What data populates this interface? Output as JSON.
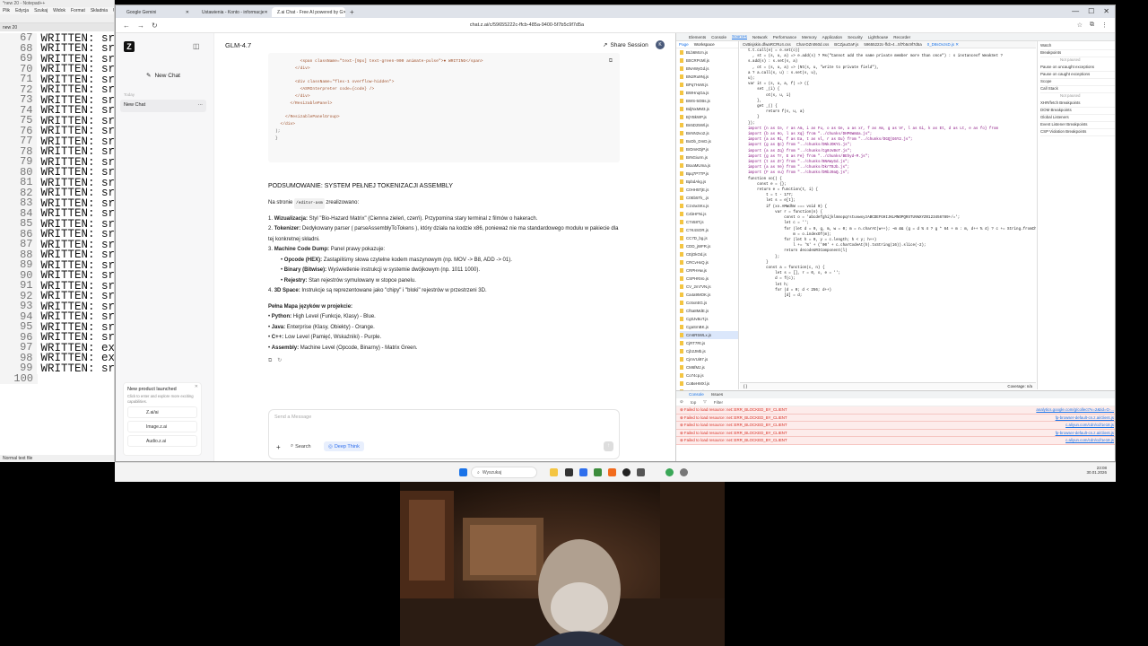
{
  "notepad": {
    "title": "*new 20 - Notepad++",
    "menu": [
      "Plik",
      "Edycja",
      "Szukaj",
      "Widok",
      "Format",
      "Składnia",
      "Ustawienia"
    ],
    "lines": [
      {
        "n": "67",
        "t": "WRITTEN: sr"
      },
      {
        "n": "68",
        "t": "WRITTEN: sr"
      },
      {
        "n": "69",
        "t": "WRITTEN: sr"
      },
      {
        "n": "70",
        "t": "WRITTEN: sr"
      },
      {
        "n": "71",
        "t": "WRITTEN: sr"
      },
      {
        "n": "72",
        "t": "WRITTEN: sr"
      },
      {
        "n": "73",
        "t": "WRITTEN: sr"
      },
      {
        "n": "74",
        "t": "WRITTEN: sr"
      },
      {
        "n": "75",
        "t": "WRITTEN: sr"
      },
      {
        "n": "76",
        "t": "WRITTEN: sr"
      },
      {
        "n": "77",
        "t": "WRITTEN: sr"
      },
      {
        "n": "78",
        "t": "WRITTEN: sr"
      },
      {
        "n": "79",
        "t": "WRITTEN: sr"
      },
      {
        "n": "80",
        "t": "WRITTEN: sr"
      },
      {
        "n": "81",
        "t": "WRITTEN: sr"
      },
      {
        "n": "82",
        "t": "WRITTEN: sr"
      },
      {
        "n": "83",
        "t": "WRITTEN: sr"
      },
      {
        "n": "84",
        "t": "WRITTEN: sr"
      },
      {
        "n": "85",
        "t": "WRITTEN: sr"
      },
      {
        "n": "86",
        "t": "WRITTEN: sr"
      },
      {
        "n": "87",
        "t": "WRITTEN: sr"
      },
      {
        "n": "88",
        "t": "WRITTEN: sr"
      },
      {
        "n": "89",
        "t": "WRITTEN: sr"
      },
      {
        "n": "90",
        "t": "WRITTEN: sr"
      },
      {
        "n": "91",
        "t": "WRITTEN: sr"
      },
      {
        "n": "92",
        "t": "WRITTEN: sr"
      },
      {
        "n": "93",
        "t": "WRITTEN: sr"
      },
      {
        "n": "94",
        "t": "WRITTEN: sr"
      },
      {
        "n": "95",
        "t": "WRITTEN: sr"
      },
      {
        "n": "96",
        "t": "WRITTEN: sr"
      },
      {
        "n": "97",
        "t": "WRITTEN: ex"
      },
      {
        "n": "98",
        "t": "WRITTEN: ex"
      },
      {
        "n": "99",
        "t": "WRITTEN: sr"
      },
      {
        "n": "100",
        "t": ""
      }
    ],
    "status": "Normal text file"
  },
  "browser": {
    "tabs": [
      {
        "label": "Google Gemini",
        "active": false
      },
      {
        "label": "Ustawienia - Konto - informacje",
        "active": false
      },
      {
        "label": "Z.ai Chat - Free AI powered by G",
        "active": true
      }
    ],
    "url": "chat.z.ai/c/59655222c-ffcb-485a-9400-5f7b5c9f7d5a"
  },
  "glm": {
    "new_chat": "New Chat",
    "today": "Today",
    "history_item": "New Chat",
    "promo_title": "New product launched",
    "promo_text": "Click to enter and explore more exciting capabilities.",
    "promo_links": [
      "Z.ai/ai",
      "Image.z.ai",
      "Audio.z.ai"
    ],
    "model": "GLM-4.7",
    "share": "Share Session",
    "code_lines": [
      "          <span className=\"text-[9px] text-green-900 animate-pulse\">● WRITING</span>",
      "        </div>",
      "",
      "        <div className=\"flex-1 overflow-hidden\">",
      "          <ASMInterpreter code={code} />",
      "        </div>",
      "      </ResizablePanel>",
      "",
      "    </ResizablePanelGroup>",
      "  </div>",
      ");",
      "}"
    ],
    "heading": "PODSUMOWANIE: SYSTEM PEŁNEJ TOKENIZACJI ASSEMBLY",
    "intro_pre": "Na stronie",
    "intro_code": "/editor-asm",
    "intro_post": "zrealizowano:",
    "items": [
      {
        "num": "1.",
        "bold": "Wizualizacja:",
        "text": " Styl \"Bio-Hazard Matrix\" (Ciemna zieleń, czerń). Przypomina stary terminal z filmów o hakerach."
      },
      {
        "num": "2.",
        "bold": "Tokenizer:",
        "text": " Dedykowany parser ( parseAssemblyToTokens ), który działa na kodzie x86, ponieważ nie ma standardowego modułu w pakiecie dla tej konkretnej składni."
      },
      {
        "num": "3.",
        "bold": "Machine Code Dump:",
        "text": " Panel prawy pokazuje:"
      }
    ],
    "subitems": [
      {
        "bold": "Opcode (HEX):",
        "text": " Zastąpiliśmy słowa czytelne kodem maszynowym (np. MOV -> B8, ADD -> 01)."
      },
      {
        "bold": "Binary (Bitwise):",
        "text": " Wyświetlenie instrukcji w systemie dwójkowym (np. 1011 1000)."
      },
      {
        "bold": "Rejestry:",
        "text": " Stan rejestrów symulowany w stopce panelu."
      }
    ],
    "item4": {
      "num": "4.",
      "bold": "3D Space:",
      "text": " Instrukcje są reprezentowane jako \"chipy\" i \"bloki\" rejestrów w przestrzeni 3D."
    },
    "map_title": "Pełna Mapa języków w projekcie:",
    "map": [
      {
        "bold": "Python:",
        "text": " High Level (Funkcje, Klasy) - Blue."
      },
      {
        "bold": "Java:",
        "text": " Enterprise (Klasy, Obiekty) - Orange."
      },
      {
        "bold": "C++:",
        "text": " Low Level (Pamięć, Wskaźniki) - Purple."
      },
      {
        "bold": "Assembly:",
        "text": " Machine Level (Opcode, Binarny) - Matrix Green."
      }
    ],
    "input_placeholder": "Send a Message",
    "search": "Search",
    "deep_think": "Deep Think"
  },
  "devtools": {
    "panels": [
      "Elements",
      "Console",
      "Sources",
      "Network",
      "Performance",
      "Memory",
      "Application",
      "Security",
      "Lighthouse",
      "Recorder"
    ],
    "active_panel": "Sources",
    "nav_tabs": [
      "Page",
      "Workspace"
    ],
    "files": [
      "BLb6Mcm.js",
      "B0CRPcMl.js",
      "BNAWyGd.js",
      "BN2Ru9Nj.js",
      "BPq7HxW.js",
      "BWHnqGa.js",
      "BWS-5OBs.js",
      "BdjNxMM3.js",
      "BjYBkWP.js",
      "Bn5D25Wl.js",
      "BnNN2vo2.js",
      "BoDb_DmD.js",
      "BrDmKDjP.js",
      "BrNGiurm.js",
      "BsxaMUma.js",
      "Bpq7P7TP.js",
      "BpbdAkg.js",
      "C0HH5TjE.js",
      "C0Eb5Tk_.js",
      "C1VaxSKx.js",
      "C4bHFNi.js",
      "C7n58T.js",
      "C7K4SOR.js",
      "CC7D_bg.js",
      "CDD_jWFR.js",
      "CEjDkOd.js",
      "CRCvHxQ.js",
      "CRPHHw.js",
      "CSPHNVo.js",
      "CV_2m7VN.js",
      "Ca4a9MOK.js",
      "Cc6xnEG.js",
      "Cf5a8MdE.js",
      "Cg0JvBoT.js",
      "CgaSmBK.js",
      "Cm6R5WLx.js",
      "CjRT7Rt.js",
      "Cjb2JMb.js",
      "CjmVUi97.js",
      "CM6fMJ.js",
      "Co74cp.js",
      "CoBeHMXl.js",
      "CqjVV_o.js",
      "D0QbUOM7.js",
      "DdwbCRM.js",
      "DTzG6ppk.js",
      "DTVCHvwK.js",
      "DBhQ9c.js"
    ],
    "code_lines": [
      "  t.t.call(e) = e.set(o))",
      "    , st = (s, u, a) => e.add(s) ? Ms(\"Cannot add the same private member more than once\") : s instanceof WeakSet ?",
      "  s.add(s) : s.set(s, a)",
      "    , ot = (s, u, a) => (Nt(s, u, \"write to private field\"),",
      "  a ? a.call(s, u) : s.set(s, u),",
      "  u);",
      "  var it = (s, u, a, f) => ({",
      "      set _(i) {",
      "          ot(s, u, i)",
      "      },",
      "      get _() {",
      "          return f(s, u, a)",
      "      }",
      "  });",
      "  import {n as Ce, r as Am, i as Fu, o as Ge, a as xr, f as Am, g as Vr, l as Gi, k as Et, d as Lt, e as fo} from",
      "  import {b as Ho, l as Xq} from \"../chunks/DHP6WmUa.js\";",
      "  import {a as Ri, f as Ea, t as vl, r as Eu} from \"../chunks/DGQjG6Y2.js\";",
      "  import {g as Qc} from \"../chunks/DNkJOKY1.js\";",
      "  import {a as Zq} from \"../chunks/Cg0JvBoT.js\";",
      "  import {g as Tr, E as Fe} from \"../chunks/BEhyd-M.js\";",
      "  import {t as Zr} from \"../chunks/BNAWyGd.js\";",
      "  import {a as Ve} from \"../chunks/DkrTBJb.js\";",
      "  import {F as su} from \"../chunks/DRbJ0aQ.js\";",
      "  function xo() {",
      "      const e = {};",
      "      return e = function(t, i) {",
      "          t = t - 177;",
      "          let s = e[t];",
      "          if (xo.AMWdhW === void 0) {",
      "              var r = function(n) {",
      "                  const o = 'abcdefghijklmnopqrstuvwxyzABCDEFGHIJKLMNOPQRSTUVWXYZ0123456789+/=';",
      "                  let c = '';",
      "                  for (let d = 0, g, m, w = 0; m = n.charAt(w++); ~m && (g = d % 4 ? g * 64 + m : m, d++ % 4) ? c += String.fromCharCode(255 & g >> (-2 * d & 6)) : 0)",
      "                      m = o.indexOf(m);",
      "                  for (let h = 0, y = c.length; h < y; h++)",
      "                      l += '%' + ('00' + c.charCodeAt(h).toString(16)).slice(-2);",
      "                  return decodeURIComponent(l)",
      "              };",
      "          }",
      "          const a = function(c, n) {",
      "              let s = [], r = 0, o, e = '';",
      "              d = f(c);",
      "              let h;",
      "              for (d = 0; d < 256; d++)",
      "                  [d] = d;"
    ],
    "footer_left": "{ }",
    "footer_right": "Coverage: n/a",
    "right_sections": [
      "Watch",
      "Breakpoints",
      "Pause on uncaught exceptions",
      "Pause on caught exceptions",
      "Scope",
      "Call Stack",
      "XHR/fetch Breakpoints",
      "DOM Breakpoints",
      "Global Listeners",
      "Event Listener Breakpoints",
      "CSP Violation Breakpoints"
    ],
    "not_paused": "Not paused",
    "drawer_tabs": [
      "Console",
      "Issues"
    ],
    "console_filter": "Filter",
    "console_top": "top",
    "errors": [
      {
        "msg": "Failed to load resource: net::ERR_BLOCKED_BY_CLIENT",
        "src": "analytics.google.com/g/collect?v=2&tid=G-..."
      },
      {
        "msg": "Failed to load resource: net::ERR_BLOCKED_BY_CLIENT",
        "src": "fp-browser-default-cn.z.ai/client.js"
      },
      {
        "msg": "Failed to load resource: net::ERR_BLOCKED_BY_CLIENT",
        "src": "c.aliyun.com/cdn/cd/1e18.js"
      },
      {
        "msg": "Failed to load resource: net::ERR_BLOCKED_BY_CLIENT",
        "src": "fp-browser-default-cn.z.ai/client.js"
      },
      {
        "msg": "Failed to load resource: net::ERR_BLOCKED_BY_CLIENT",
        "src": "c.aliyun.com/cdn/cd/1e18.js"
      }
    ]
  },
  "taskbar": {
    "search_placeholder": "Wyszukaj",
    "time": "23:08",
    "date": "30.01.2026"
  },
  "colors": {
    "accent": "#2f6fed",
    "error": "#d93025",
    "error_bg": "#fdeceb",
    "code_green": "#1e7d32"
  }
}
